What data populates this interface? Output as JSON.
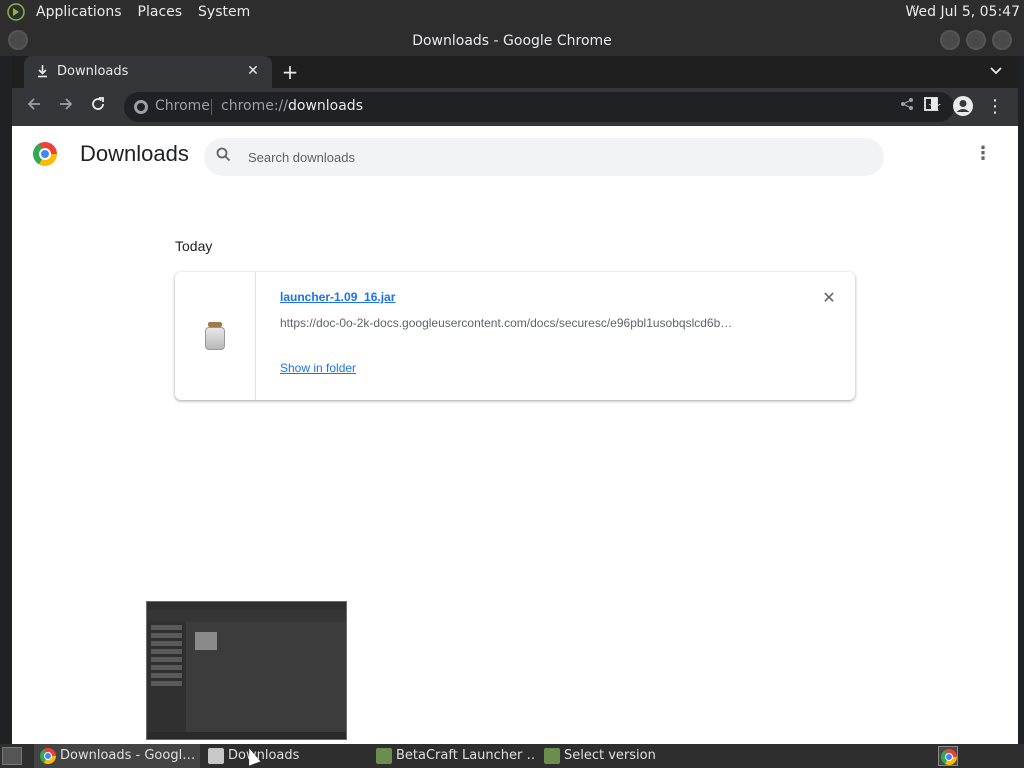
{
  "top_panel": {
    "menus": [
      "Applications",
      "Places",
      "System"
    ],
    "clock": "Wed Jul  5, 05:47"
  },
  "window": {
    "title": "Downloads - Google Chrome"
  },
  "tab": {
    "title": "Downloads",
    "icon": "download-icon"
  },
  "toolbar": {
    "site_label": "Chrome",
    "url_scheme": "chrome://",
    "url_host": "downloads"
  },
  "page": {
    "title": "Downloads",
    "search_placeholder": "Search downloads",
    "date_group": "Today",
    "download": {
      "file_name": "launcher-1.09_16.jar",
      "url": "https://doc-0o-2k-docs.googleusercontent.com/docs/securesc/e96pbl1usobqslcd6b…",
      "action": "Show in folder"
    }
  },
  "taskbar": {
    "items": [
      {
        "label": "Downloads - Googl…",
        "icon": "chrome-icon"
      },
      {
        "label": "Downloads",
        "icon": "folder-icon"
      },
      {
        "label": "BetaCraft Launcher …",
        "icon": "betacraft-icon"
      },
      {
        "label": "Select version",
        "icon": "betacraft-icon"
      }
    ]
  }
}
